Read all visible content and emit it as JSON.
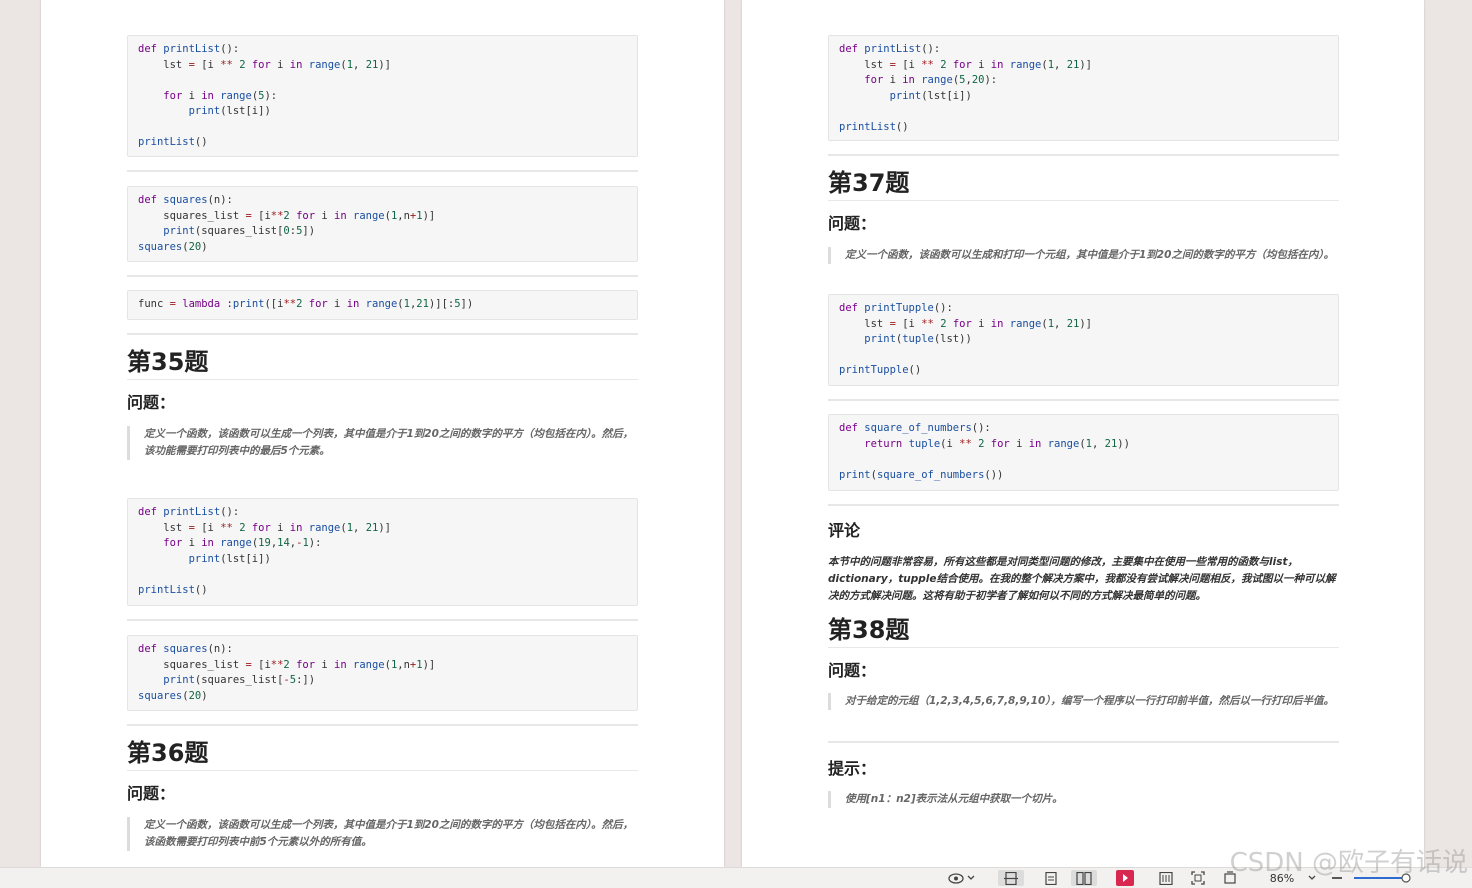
{
  "left_page": {
    "code1": [
      "def printList():",
      "    lst = [i ** 2 for i in range(1, 21)]",
      "",
      "    for i in range(5):",
      "        print(lst[i])",
      "",
      "printList()"
    ],
    "code2": [
      "def squares(n):",
      "    squares_list = [i**2 for i in range(1,n+1)]",
      "    print(squares_list[0:5])",
      "squares(20)"
    ],
    "code3": [
      "func = lambda :print([i**2 for i in range(1,21)][:5])"
    ],
    "q35_title": "第35题",
    "q35_label": "问题：",
    "q35_text": "定义一个函数，该函数可以生成一个列表，其中值是介于1到20之间的数字的平方（均包括在内）。然后，该功能需要打印列表中的最后5个元素。",
    "code4": [
      "def printList():",
      "    lst = [i ** 2 for i in range(1, 21)]",
      "    for i in range(19,14,-1):",
      "        print(lst[i])",
      "",
      "printList()"
    ],
    "code5": [
      "def squares(n):",
      "    squares_list = [i**2 for i in range(1,n+1)]",
      "    print(squares_list[-5:])",
      "squares(20)"
    ],
    "q36_title": "第36题",
    "q36_label": "问题：",
    "q36_text": "定义一个函数，该函数可以生成一个列表，其中值是介于1到20之间的数字的平方（均包括在内）。然后，该函数需要打印列表中前5个元素以外的所有值。"
  },
  "right_page": {
    "code1": [
      "def printList():",
      "    lst = [i ** 2 for i in range(1, 21)]",
      "    for i in range(5,20):",
      "        print(lst[i])",
      "",
      "printList()"
    ],
    "q37_title": "第37题",
    "q37_label": "问题：",
    "q37_text": "定义一个函数，该函数可以生成和打印一个元组，其中值是介于1到20之间的数字的平方（均包括在内）。",
    "code2": [
      "def printTupple():",
      "    lst = [i ** 2 for i in range(1, 21)]",
      "    print(tuple(lst))",
      "",
      "printTupple()"
    ],
    "code3": [
      "def square_of_numbers():",
      "    return tuple(i ** 2 for i in range(1, 21))",
      "",
      "print(square_of_numbers())"
    ],
    "comment_title": "评论",
    "comment_text": "本节中的问题非常容易，所有这些都是对同类型问题的修改，主要集中在使用一些常用的函数与list，dictionary，tupple结合使用。在我的整个解决方案中，我都没有尝试解决问题相反，我试图以一种可以解决的方式解决问题。这将有助于初学者了解如何以不同的方式解决最简单的问题。",
    "q38_title": "第38题",
    "q38_label": "问题：",
    "q38_text": "对于给定的元组（1,2,3,4,5,6,7,8,9,10），编写一个程序以一行打印前半值，然后以一行打印后半值。",
    "hint_label": "提示：",
    "hint_text": "使用[n1：n2]表示法从元组中获取一个切片。"
  },
  "statusbar": {
    "zoom": "86%",
    "icons": [
      "eye-icon",
      "chevron-down-icon",
      "single-page-icon",
      "scroll-page-icon",
      "two-page-icon",
      "play-icon",
      "fit-width-icon",
      "fullscreen-icon",
      "rotate-icon",
      "chevron-down-icon",
      "zoom-out-icon",
      "zoom-slider"
    ],
    "accent": "#d8284f"
  },
  "watermark": "CSDN @欧子有话说"
}
